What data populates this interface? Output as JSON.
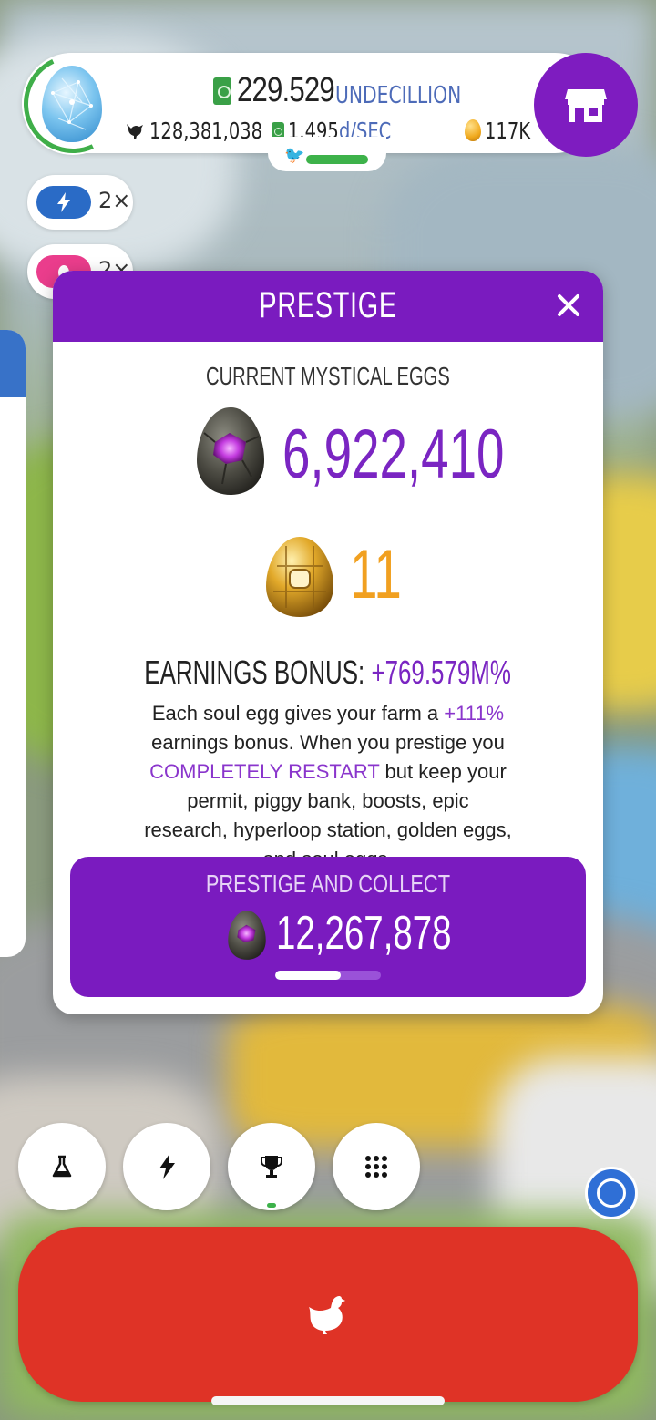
{
  "hud": {
    "money_value": "229.529",
    "money_unit": "UNDECILLION",
    "chickens": "128,381,038",
    "earning_rate": "1.495",
    "earning_rate_unit": "d/SEC",
    "golden_eggs": "117K",
    "hab_progress": 0.75
  },
  "boosts": [
    {
      "icon": "lightning-icon",
      "multiplier": "2×"
    },
    {
      "icon": "egg-icon",
      "multiplier": "2×"
    }
  ],
  "modal": {
    "title": "PRESTIGE",
    "current_label": "CURRENT MYSTICAL EGGS",
    "soul_eggs": "6,922,410",
    "golden_eggs": "11",
    "earnings_label": "EARNINGS BONUS:",
    "earnings_value": "+769.579M%",
    "desc_1": "Each soul egg gives your farm a ",
    "desc_hl1": "+111%",
    "desc_2": " earnings bonus. When you prestige you ",
    "desc_hl2": "COMPLETELY RESTART",
    "desc_3": " but keep your permit, piggy bank, boosts, epic research, hyperloop station, golden eggs, and soul eggs.",
    "button_label": "PRESTIGE AND COLLECT",
    "button_value": "12,267,878",
    "button_progress": 0.62
  },
  "nav": {
    "items": [
      "research-flask-icon",
      "boost-lightning-icon",
      "trophy-icon",
      "menu-grid-icon"
    ],
    "active": "trophy-icon"
  },
  "colors": {
    "purple": "#7a1bbf",
    "hatch_red": "#df3326",
    "accent_blue": "#4d6bb8",
    "gold": "#f1a020",
    "green": "#3db24a"
  }
}
